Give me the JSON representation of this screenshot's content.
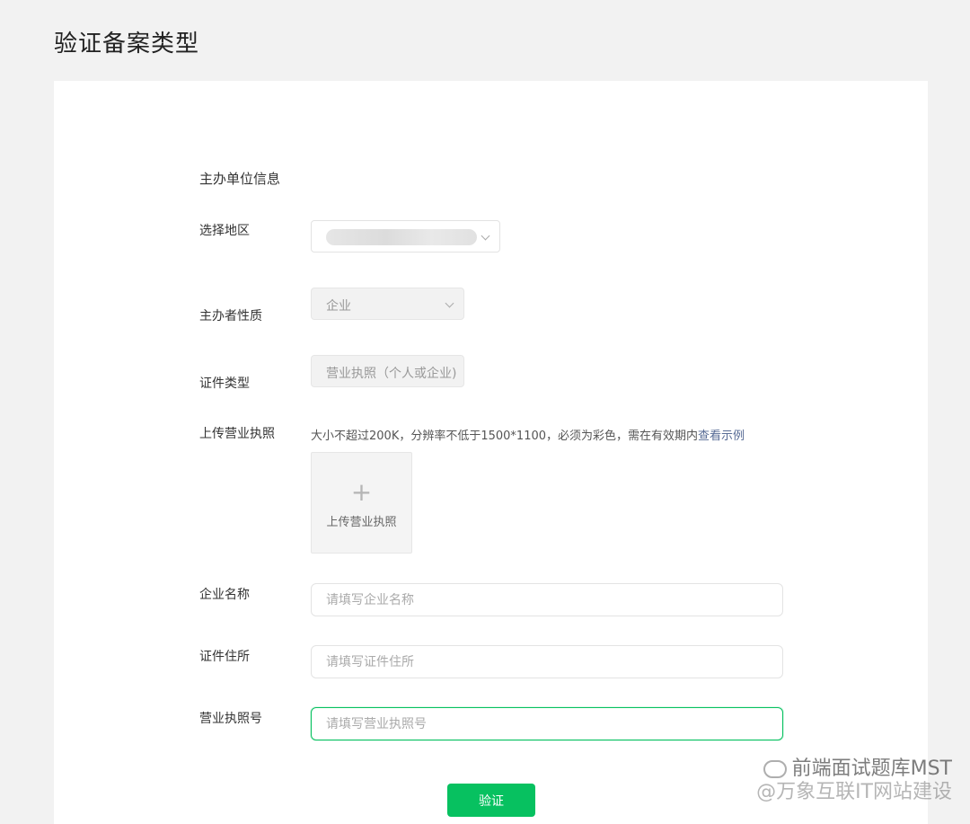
{
  "page": {
    "title": "验证备案类型"
  },
  "form": {
    "section_title": "主办单位信息",
    "region": {
      "label": "选择地区",
      "value": ""
    },
    "organizer_type": {
      "label": "主办者性质",
      "value": "企业"
    },
    "certificate_type": {
      "label": "证件类型",
      "value": "营业执照（个人或企业)"
    },
    "upload": {
      "label": "上传营业执照",
      "hint": "大小不超过200K，分辨率不低于1500*1100，必须为彩色，需在有效期内",
      "example_link": "查看示例",
      "box_label": "上传营业执照",
      "plus_icon": "+"
    },
    "company_name": {
      "label": "企业名称",
      "placeholder": "请填写企业名称"
    },
    "address": {
      "label": "证件住所",
      "placeholder": "请填写证件住所"
    },
    "license_number": {
      "label": "营业执照号",
      "placeholder": "请填写营业执照号"
    },
    "submit_label": "验证"
  },
  "watermark": {
    "line1": "前端面试题库MST",
    "line2": "@万象互联IT网站建设"
  },
  "colors": {
    "accent": "#07c160",
    "link": "#576b95"
  }
}
